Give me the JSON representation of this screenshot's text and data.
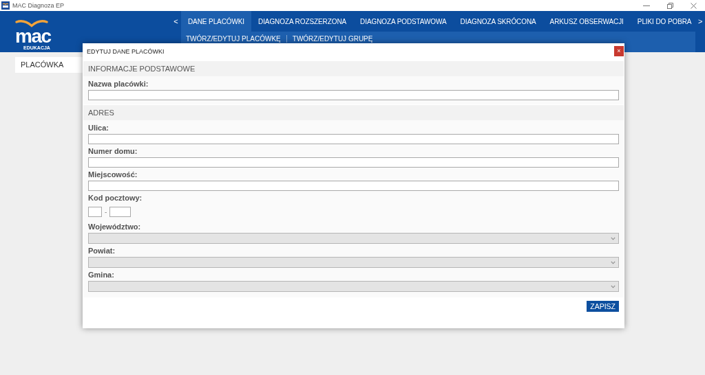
{
  "window": {
    "title": "MAC Diagnoza EP"
  },
  "logo": {
    "wordmark": "mac",
    "tagline": "EDUKACJA"
  },
  "nav": {
    "prev": "<",
    "next": ">",
    "tabs": [
      {
        "label": "DANE PLACÓWKI",
        "selected": true
      },
      {
        "label": "DIAGNOZA ROZSZERZONA",
        "selected": false
      },
      {
        "label": "DIAGNOZA PODSTAWOWA",
        "selected": false
      },
      {
        "label": "DIAGNOZA SKRÓCONA",
        "selected": false
      },
      {
        "label": "ARKUSZ OBSERWACJI",
        "selected": false
      },
      {
        "label": "PLIKI DO POBRA",
        "selected": false
      }
    ]
  },
  "subnav": {
    "links": [
      "TWÓRZ/EDYTUJ PLACÓWKĘ",
      "TWÓRZ/EDYTUJ GRUPĘ"
    ]
  },
  "sidebar": {
    "items": [
      "PLACÓWKA"
    ]
  },
  "dialog": {
    "title": "EDYTUJ DANE PLACÓWKI",
    "close": "×",
    "sections": [
      {
        "heading": "INFORMACJE PODSTAWOWE",
        "fields": [
          {
            "kind": "text",
            "label": "Nazwa placówki:",
            "disabled": false
          }
        ]
      },
      {
        "heading": "ADRES",
        "fields": [
          {
            "kind": "text",
            "label": "Ulica:",
            "disabled": false
          },
          {
            "kind": "text",
            "label": "Numer domu:",
            "disabled": false
          },
          {
            "kind": "text",
            "label": "Miejscowość:",
            "disabled": false
          },
          {
            "kind": "postal",
            "label": "Kod pocztowy:",
            "separator": "-",
            "disabled": false
          },
          {
            "kind": "select",
            "label": "Województwo:",
            "disabled": true
          },
          {
            "kind": "select",
            "label": "Powiat:",
            "disabled": true
          },
          {
            "kind": "select",
            "label": "Gmina:",
            "disabled": true
          }
        ]
      }
    ],
    "submit": "ZAPISZ"
  }
}
